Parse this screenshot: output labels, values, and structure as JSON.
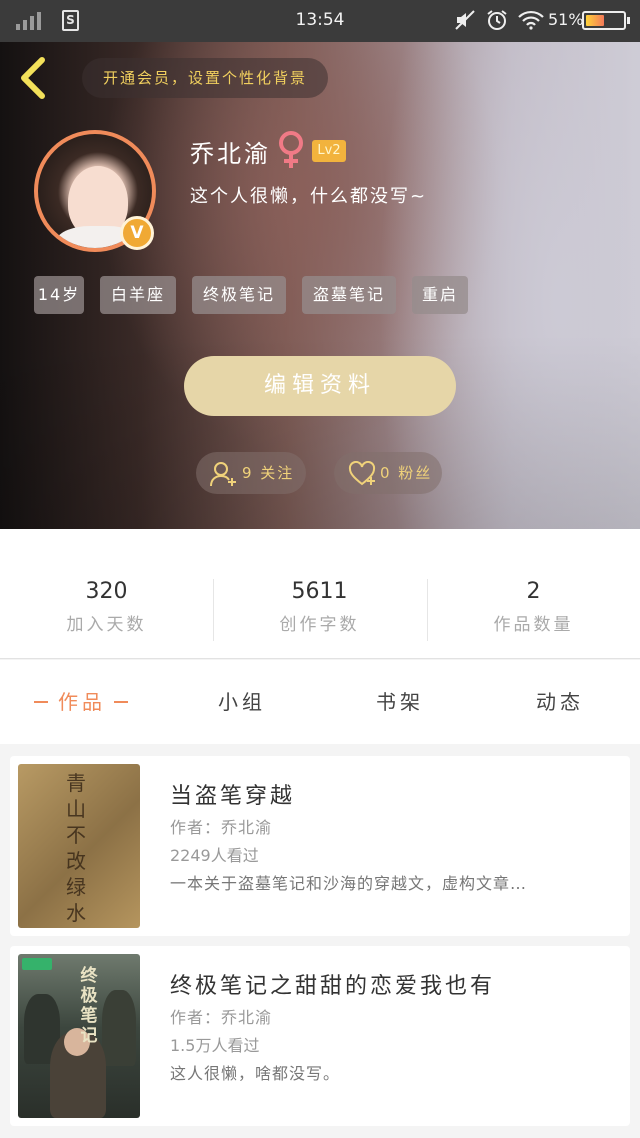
{
  "status_bar": {
    "time": "13:54",
    "battery_text": "51%",
    "battery_level": 0.51,
    "sim_label": "S",
    "icons": [
      "signal-icon",
      "sim-icon",
      "mute-icon",
      "alarm-icon",
      "wifi-icon",
      "battery-icon"
    ]
  },
  "header": {
    "vip_banner": "开通会员，设置个性化背景",
    "username": "乔北渝",
    "gender": "female-icon",
    "level": "Lv2",
    "verified_badge": "V",
    "bio": "这个人很懒，什么都没写~",
    "tags": [
      "14岁",
      "白羊座",
      "终极笔记",
      "盗墓笔记",
      "重启"
    ],
    "edit_button": "编辑资料",
    "following": "9 关注",
    "followers": "0 粉丝"
  },
  "stats": [
    {
      "value": "320",
      "label": "加入天数"
    },
    {
      "value": "5611",
      "label": "创作字数"
    },
    {
      "value": "2",
      "label": "作品数量"
    }
  ],
  "tabs": [
    {
      "label": "作品",
      "active": true
    },
    {
      "label": "小组",
      "active": false
    },
    {
      "label": "书架",
      "active": false
    },
    {
      "label": "动态",
      "active": false
    }
  ],
  "works": [
    {
      "title": "当盗笔穿越",
      "author": "作者：乔北渝",
      "views": "2249人看过",
      "desc": "一本关于盗墓笔记和沙海的穿越文，虚构文章…",
      "cover_text": "青山不改 绿水长流"
    },
    {
      "title": "终极笔记之甜甜的恋爱我也有",
      "author": "作者：乔北渝",
      "views": "1.5万人看过",
      "desc": "这人很懒，啥都没写。",
      "cover_text": "终极笔记"
    }
  ],
  "colors": {
    "accent": "#f08b5a",
    "gold": "#f0cf5e",
    "edit_button_bg": "#e6d6a8",
    "level_badge": "#f2b33d"
  }
}
